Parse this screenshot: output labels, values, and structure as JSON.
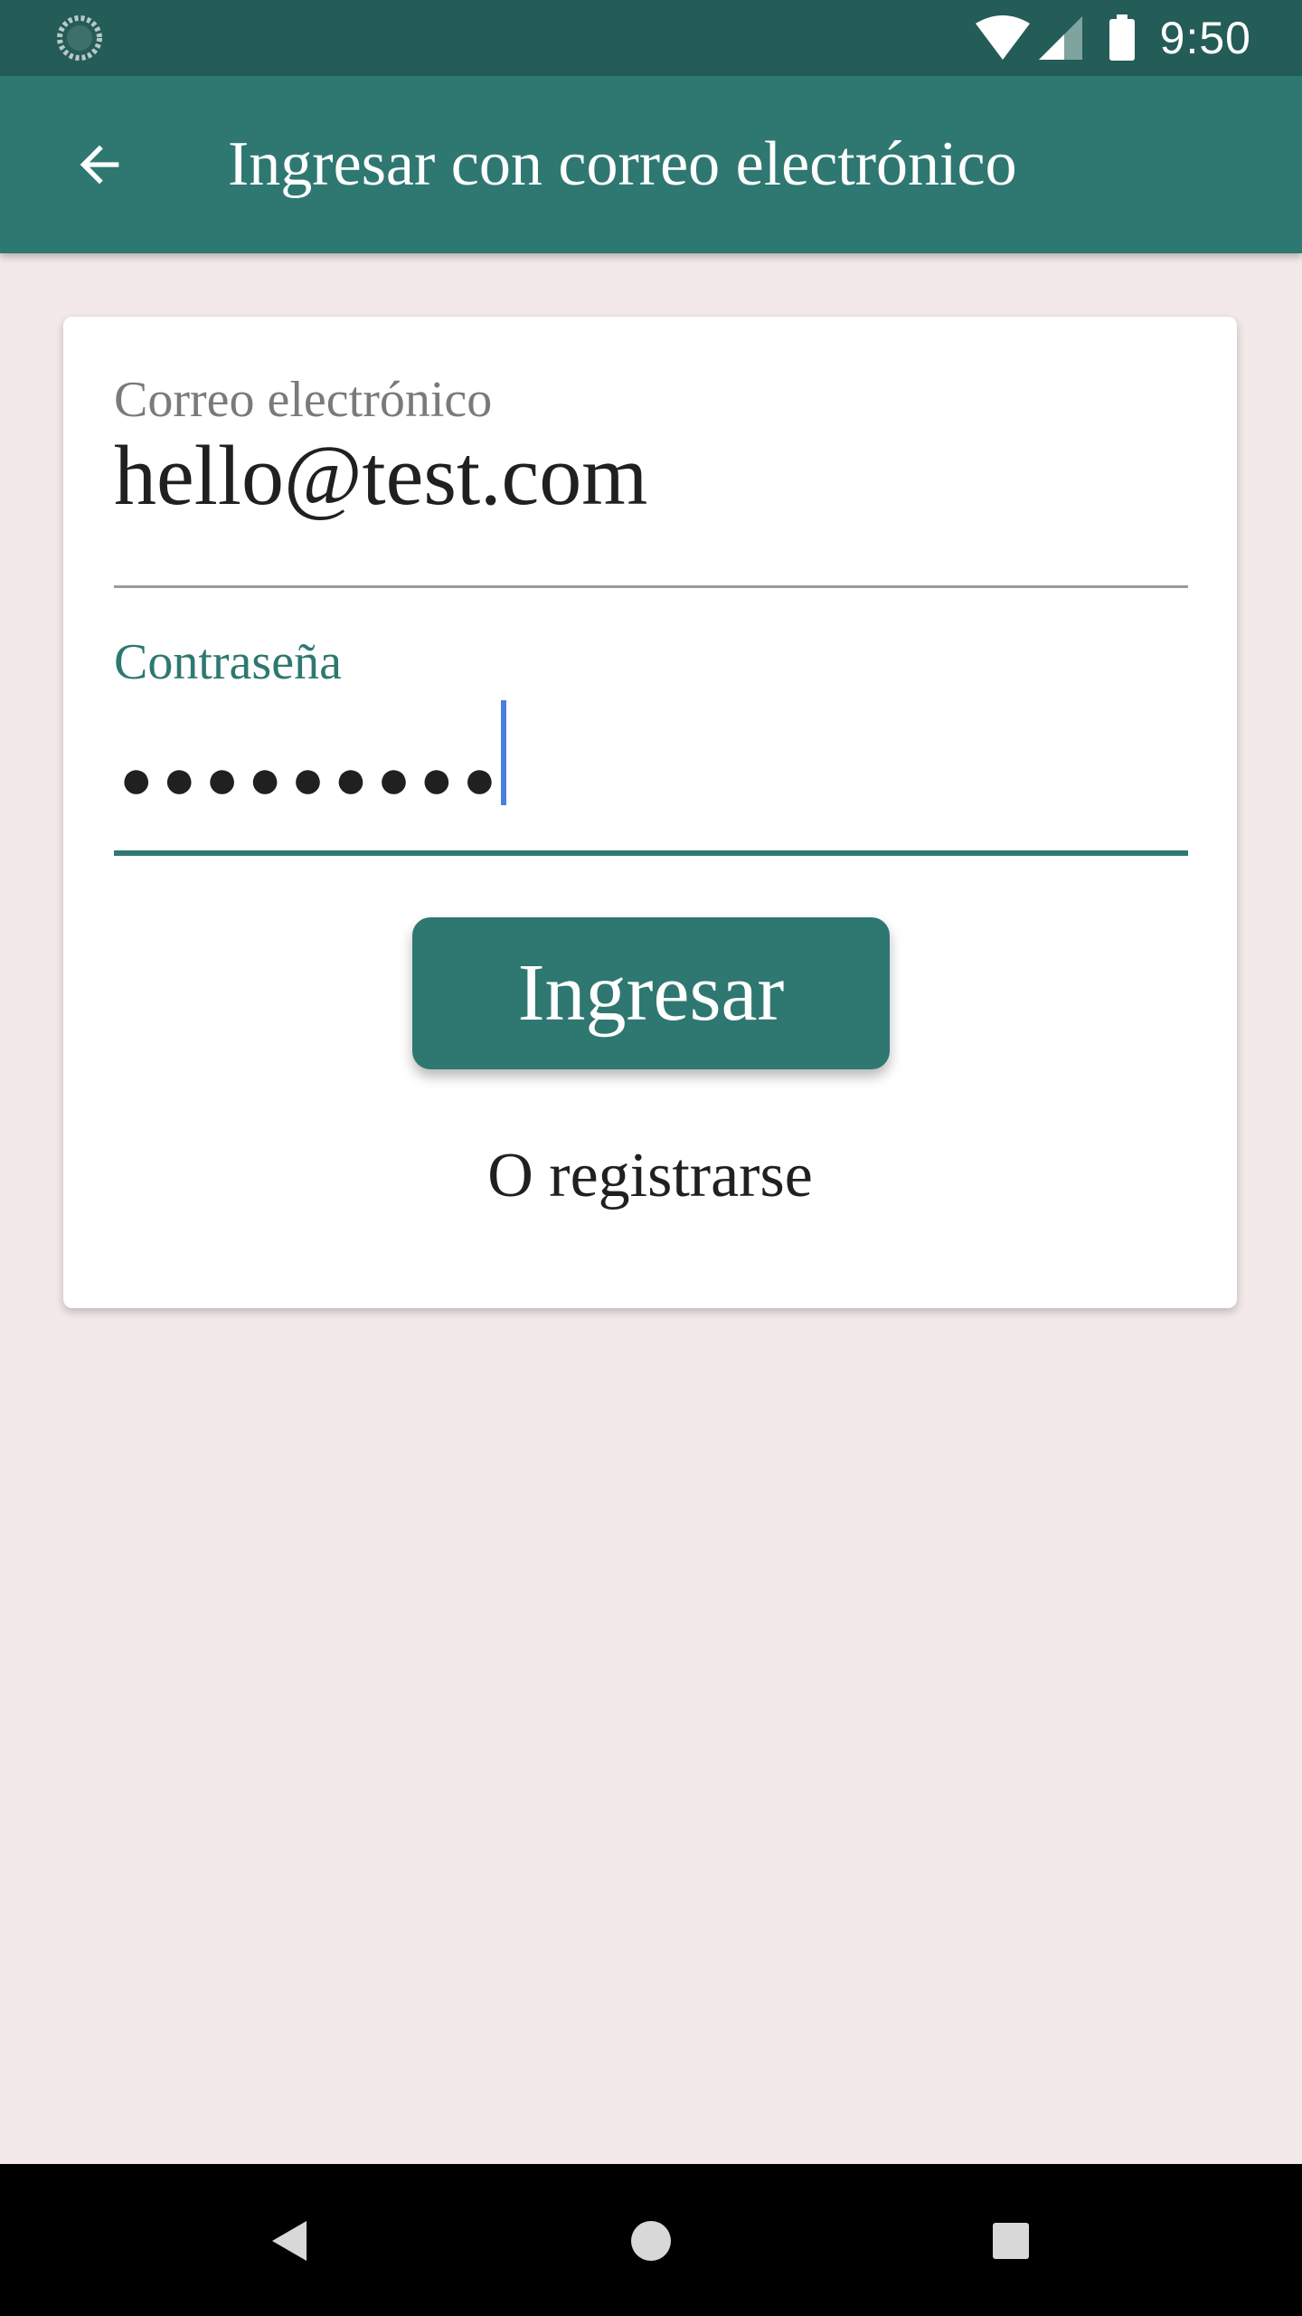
{
  "status_bar": {
    "time": "9:50",
    "icons": [
      "sync-icon",
      "wifi-icon",
      "signal-icon",
      "battery-icon"
    ]
  },
  "app_bar": {
    "title": "Ingresar con correo electrónico",
    "back_icon": "arrow-back-icon"
  },
  "form": {
    "email": {
      "label": "Correo electrónico",
      "value": "hello@test.com"
    },
    "password": {
      "label": "Contraseña",
      "masked_value": "●●●●●●●●●"
    },
    "submit_label": "Ingresar",
    "register_label": "O registrarse"
  },
  "nav_bar": {
    "icons": [
      "nav-back-icon",
      "nav-home-icon",
      "nav-recents-icon"
    ]
  },
  "colors": {
    "status_bar": "#245c57",
    "primary": "#2e7871",
    "background": "#f3e9e8",
    "caret": "#4a7fe0"
  }
}
